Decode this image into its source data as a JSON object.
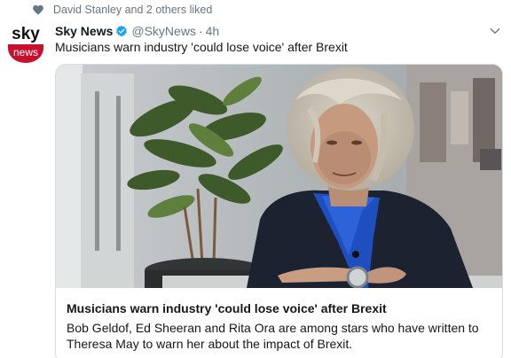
{
  "social_context": {
    "text": "David Stanley and 2 others liked",
    "icon": "heart-icon"
  },
  "tweet": {
    "author_name": "Sky News",
    "handle": "@SkyNews",
    "separator": "·",
    "time": "4h",
    "text": "Musicians warn industry 'could lose voice' after Brexit",
    "verified_color": "#1da1f2"
  },
  "avatar": {
    "logo_top": "sky",
    "logo_bottom": "news",
    "brand_color": "#c8102e"
  },
  "card": {
    "title": "Musicians warn industry 'could lose voice' after Brexit",
    "description": "Bob Geldof, Ed Sheeran and Rita Ora are among stars who have written to Theresa May to warn her about the impact of Brexit."
  }
}
